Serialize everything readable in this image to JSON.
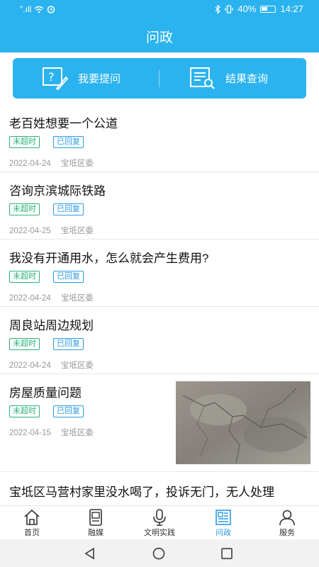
{
  "status_bar": {
    "left": "″.ıll",
    "battery": "40%",
    "time": "14:27"
  },
  "header": {
    "title": "问政"
  },
  "actions": [
    {
      "label": "我要提问",
      "icon": "question-form-icon"
    },
    {
      "label": "结果查询",
      "icon": "document-search-icon"
    }
  ],
  "items": [
    {
      "title": "老百姓想要一个公道",
      "tags": [
        "未超时",
        "已回复"
      ],
      "date": "2022-04-24",
      "dept": "宝坻区委"
    },
    {
      "title": "咨询京滨城际铁路",
      "tags": [
        "未超时",
        "已回复"
      ],
      "date": "2022-04-25",
      "dept": "宝坻区委"
    },
    {
      "title": "我没有开通用水，怎么就会产生费用?",
      "tags": [
        "未超时",
        "已回复"
      ],
      "date": "2022-04-24",
      "dept": "宝坻区委"
    },
    {
      "title": "周良站周边规划",
      "tags": [
        "未超时",
        "已回复"
      ],
      "date": "2022-04-24",
      "dept": "宝坻区委"
    },
    {
      "title": "房屋质量问题",
      "tags": [
        "未超时",
        "已回复"
      ],
      "date": "2022-04-15",
      "dept": "宝坻区委",
      "image": "cracked-wall-photo"
    },
    {
      "title": "宝坻区马营村家里没水喝了，投诉无门，无人处理"
    }
  ],
  "tabs": [
    {
      "label": "首页",
      "icon": "home-icon"
    },
    {
      "label": "融媒",
      "icon": "media-icon"
    },
    {
      "label": "文明实践",
      "icon": "microphone-icon"
    },
    {
      "label": "问政",
      "icon": "newspaper-icon",
      "active": true
    },
    {
      "label": "服务",
      "icon": "person-icon"
    }
  ],
  "colors": {
    "primary": "#2bb3ef",
    "tag_green": "#2bb27a",
    "tag_blue": "#2b9be0",
    "tab_active": "#2b9be0"
  }
}
